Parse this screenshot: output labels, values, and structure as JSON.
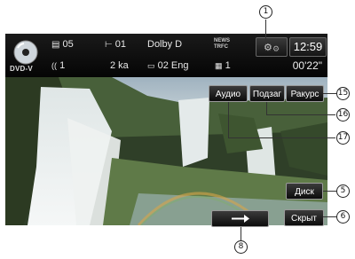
{
  "status_bar": {
    "disc_label": "DVD-V",
    "title_number": "05",
    "chapter_number": "01",
    "audio_format": "Dolby D",
    "traffic_lines": [
      "NEWS",
      "TRFC"
    ],
    "clock": "12:59",
    "audio_stream": "1",
    "channels": "2 ka",
    "subtitle": "02 Eng",
    "angle": "1",
    "elapsed_time": "00'22\""
  },
  "buttons": {
    "audio": "Аудио",
    "subtitle": "Подзаг",
    "angle": "Ракурс",
    "disc": "Диск",
    "hide": "Скрыт"
  },
  "callouts": [
    "1",
    "15",
    "16",
    "17",
    "5",
    "6",
    "8"
  ],
  "colors": {
    "button_border": "#9a9a9a",
    "button_fill": "#1a1a1a",
    "status_bg": "#0a0a0a"
  }
}
